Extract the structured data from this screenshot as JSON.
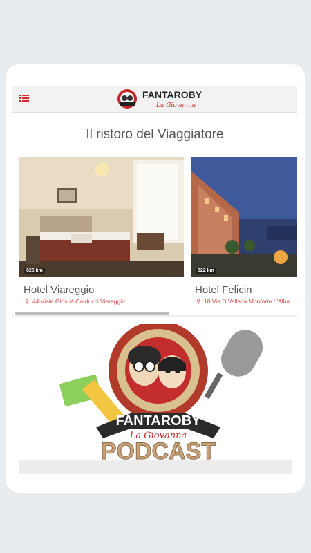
{
  "header": {
    "brand": "FANTAROBY",
    "brand_sub": "La Giovanna",
    "menu_icon": "menu-icon"
  },
  "section": {
    "title": "Il ristoro del Viaggiatore"
  },
  "hotels": [
    {
      "distance": "625 km",
      "name": "Hotel Viareggio",
      "address": "44 Viale Giosuè Carducci Viareggio"
    },
    {
      "distance": "822 km",
      "name": "Hotel Felicin",
      "address": "18 Via D.Vallada Monforte d'Alba"
    }
  ],
  "banner": {
    "brand": "FANTAROBY",
    "brand_sub": "La Giovanna",
    "label": "PODCAST"
  },
  "colors": {
    "accent": "#d62b2b",
    "title_text": "#555555"
  }
}
